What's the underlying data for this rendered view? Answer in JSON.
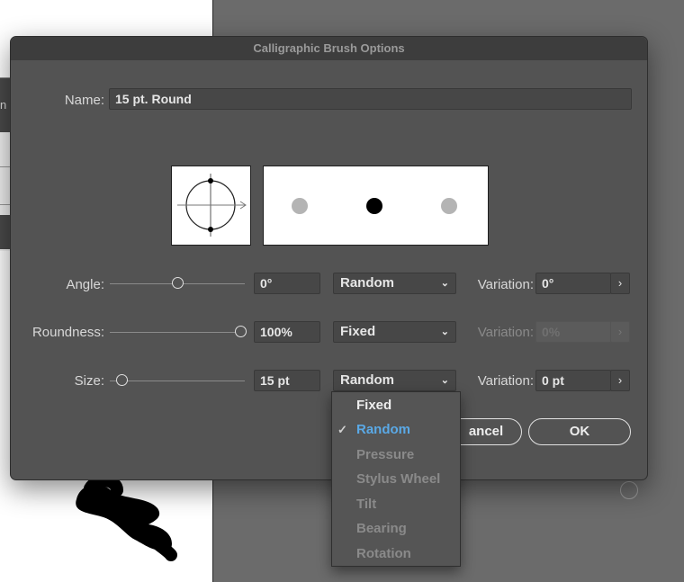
{
  "dialog": {
    "title": "Calligraphic Brush Options",
    "name_label": "Name:",
    "name_value": "15 pt. Round"
  },
  "angle": {
    "label": "Angle:",
    "value": "0°",
    "mode": "Random",
    "variation_label": "Variation:",
    "variation_value": "0°",
    "slider_level": 0.5
  },
  "roundness": {
    "label": "Roundness:",
    "value": "100%",
    "mode": "Fixed",
    "variation_label": "Variation:",
    "variation_value": "0%",
    "slider_level": 1.0
  },
  "size": {
    "label": "Size:",
    "value": "15 pt",
    "mode": "Random",
    "variation_label": "Variation:",
    "variation_value": "0 pt",
    "slider_level": 0.1
  },
  "buttons": {
    "cancel": "ancel",
    "ok": "OK"
  },
  "dropdown_menu": {
    "items": [
      {
        "label": "Fixed",
        "state": "enabled"
      },
      {
        "label": "Random",
        "state": "selected"
      },
      {
        "label": "Pressure",
        "state": "disabled"
      },
      {
        "label": "Stylus Wheel",
        "state": "disabled"
      },
      {
        "label": "Tilt",
        "state": "disabled"
      },
      {
        "label": "Bearing",
        "state": "disabled"
      },
      {
        "label": "Rotation",
        "state": "disabled"
      }
    ],
    "check_icon": "checkmark-icon"
  },
  "background_panel_label": "n",
  "colors": {
    "dialog_bg": "#535353",
    "selected_accent": "#5aa9e6",
    "disabled_text": "#8a8a8a"
  }
}
